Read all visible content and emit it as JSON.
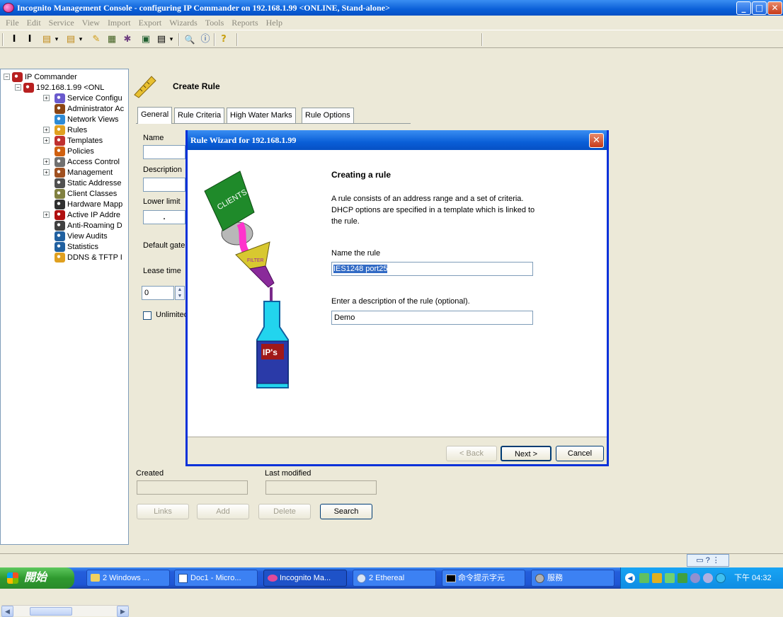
{
  "window": {
    "title": "Incognito Management Console - configuring IP Commander on 192.168.1.99 <ONLINE, Stand-alone>",
    "minimize_glyph": "_",
    "maximize_glyph": "□",
    "close_glyph": "✕"
  },
  "menu": [
    "File",
    "Edit",
    "Service",
    "View",
    "Import",
    "Export",
    "Wizards",
    "Tools",
    "Reports",
    "Help"
  ],
  "toolbar": {
    "icons": [
      "server-icon",
      "server-alt-icon",
      "open-folder-icon",
      "dropdown-icon",
      "open-folder-alt-icon",
      "dropdown-icon",
      "pencil-icon",
      "grid-icon",
      "tools-icon",
      "chart-icon",
      "document-icon",
      "dropdown-icon",
      "search-icon",
      "info-icon",
      "help-icon"
    ],
    "glyphs": [
      "I",
      "I",
      "▤",
      "▾",
      "▤",
      "▾",
      "✎",
      "▦",
      "✱",
      "▣",
      "▤",
      "▾",
      "🔍",
      "ⓘ",
      "?"
    ]
  },
  "tree": {
    "items": [
      {
        "label": "IP Commander",
        "icon": "person-server-icon",
        "color": "#b82020",
        "expander": "−",
        "depth": 0
      },
      {
        "label": "192.168.1.99 <ONL",
        "icon": "person-server-icon",
        "color": "#b82020",
        "expander": "−",
        "depth": 1
      },
      {
        "label": "Service Configu",
        "icon": "service-icon",
        "color": "#6a5acd",
        "expander": "+",
        "depth": 2
      },
      {
        "label": "Administrator Ac",
        "icon": "admin-icon",
        "color": "#8b4513",
        "expander": "",
        "depth": 2
      },
      {
        "label": "Network Views",
        "icon": "globe-icon",
        "color": "#2e8bd6",
        "expander": "",
        "depth": 2
      },
      {
        "label": "Rules",
        "icon": "ruler-icon",
        "color": "#e0a020",
        "expander": "+",
        "depth": 2
      },
      {
        "label": "Templates",
        "icon": "template-icon",
        "color": "#c03030",
        "expander": "+",
        "depth": 2
      },
      {
        "label": "Policies",
        "icon": "policy-icon",
        "color": "#d06010",
        "expander": "",
        "depth": 2
      },
      {
        "label": "Access Control",
        "icon": "lock-icon",
        "color": "#707070",
        "expander": "+",
        "depth": 2
      },
      {
        "label": "Management",
        "icon": "management-icon",
        "color": "#a05020",
        "expander": "+",
        "depth": 2
      },
      {
        "label": "Static Addresse",
        "icon": "static-icon",
        "color": "#505050",
        "expander": "",
        "depth": 2
      },
      {
        "label": "Client Classes",
        "icon": "client-icon",
        "color": "#808040",
        "expander": "",
        "depth": 2
      },
      {
        "label": "Hardware Mapp",
        "icon": "hardware-icon",
        "color": "#303030",
        "expander": "",
        "depth": 2
      },
      {
        "label": "Active IP Addre",
        "icon": "active-ip-icon",
        "color": "#b01010",
        "expander": "+",
        "depth": 2
      },
      {
        "label": "Anti-Roaming D",
        "icon": "anti-roaming-icon",
        "color": "#404040",
        "expander": "",
        "depth": 2
      },
      {
        "label": "View Audits",
        "icon": "audit-icon",
        "color": "#2060a0",
        "expander": "",
        "depth": 2
      },
      {
        "label": "Statistics",
        "icon": "statistics-icon",
        "color": "#2060a0",
        "expander": "",
        "depth": 2
      },
      {
        "label": "DDNS & TFTP I",
        "icon": "ddns-icon",
        "color": "#e0a020",
        "expander": "",
        "depth": 2
      }
    ]
  },
  "main": {
    "header_title": "Create Rule",
    "tabs": [
      "General",
      "Rule Criteria",
      "High Water Marks",
      "Rule Options"
    ],
    "labels": {
      "name": "Name",
      "description": "Description",
      "lower_limit": "Lower limit",
      "default_gateway": "Default gate",
      "lease_time": "Lease time",
      "lease_value": "0",
      "unlimited": "Unlimited",
      "ip_dot": "."
    },
    "created_label": "Created",
    "last_modified_label": "Last modified",
    "buttons": {
      "links": "Links",
      "add": "Add",
      "delete": "Delete",
      "search": "Search"
    }
  },
  "wizard": {
    "title": "Rule Wizard for 192.168.1.99",
    "heading": "Creating a rule",
    "intro": "A rule consists of an address range and a set of criteria. DHCP options are specified in a template which is linked to the rule.",
    "name_label": "Name the rule",
    "name_value": "IES1248 port25",
    "desc_label": "Enter a description of the rule (optional).",
    "desc_value": "Demo",
    "illustration": {
      "bucket_text": "CLIENTS",
      "funnel_text": "FILTER",
      "bottle_text": "IP's"
    },
    "buttons": {
      "back": "< Back",
      "next": "Next >",
      "cancel": "Cancel"
    }
  },
  "taskbar": {
    "start": "開始",
    "tasks": [
      {
        "label": "2 Windows ...",
        "icon": "folder-icon"
      },
      {
        "label": "Doc1 - Micro...",
        "icon": "word-icon"
      },
      {
        "label": "Incognito Ma...",
        "icon": "incognito-icon"
      },
      {
        "label": "2 Ethereal",
        "icon": "ethereal-icon"
      },
      {
        "label": "命令提示字元",
        "icon": "cmd-icon"
      },
      {
        "label": "服務",
        "icon": "services-icon"
      }
    ],
    "clock": "下午 04:32"
  }
}
